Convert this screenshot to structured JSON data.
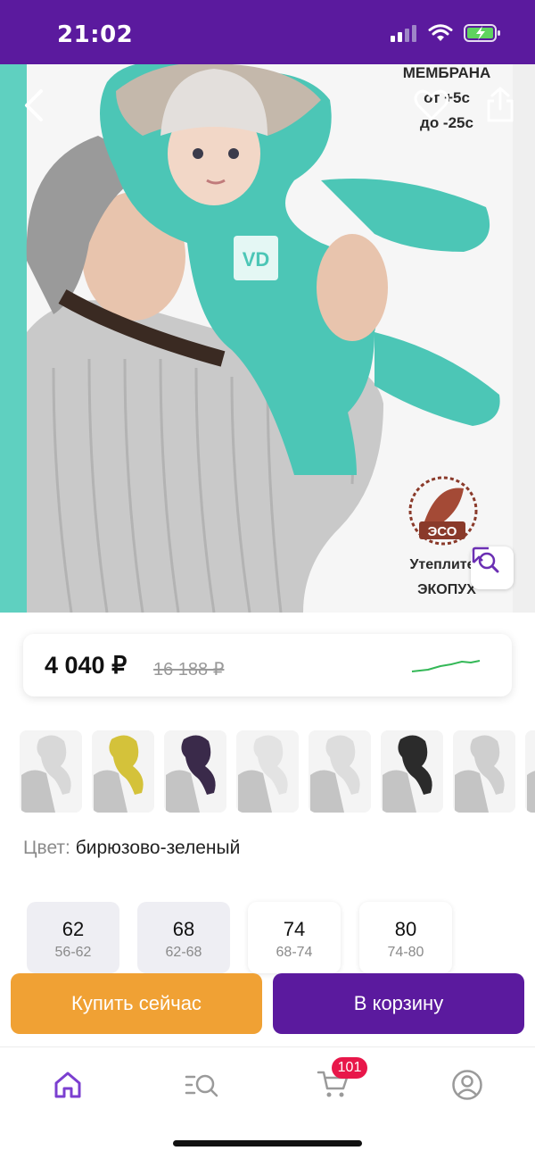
{
  "status_bar": {
    "time": "21:02"
  },
  "hero": {
    "text_membrane_line1": "МЕМБРАНА",
    "text_membrane_line2": "от +5с",
    "text_membrane_line3": "до -25с",
    "eco_stamp": "ЭСО",
    "insulation_line1": "Утеплитель",
    "insulation_line2": "ЭКОПУХ",
    "logo_text": "VD"
  },
  "price": {
    "current": "4 040 ₽",
    "old": "16 188 ₽"
  },
  "variants": {
    "count": 8,
    "colors": [
      "#d8d8d8",
      "#d4c23a",
      "#3a2a4a",
      "#e3e3e3",
      "#dddddd",
      "#2b2b2b",
      "#cfcfcf",
      "#d2d2d2"
    ]
  },
  "color": {
    "label": "Цвет:",
    "value": "бирюзово-зеленый"
  },
  "sizes": [
    {
      "size": "62",
      "range": "56-62"
    },
    {
      "size": "68",
      "range": "62-68"
    },
    {
      "size": "74",
      "range": "68-74"
    },
    {
      "size": "80",
      "range": "74-80"
    }
  ],
  "actions": {
    "buy_now": "Купить сейчас",
    "add_to_cart": "В корзину"
  },
  "tab_bar": {
    "cart_badge": "101"
  },
  "colors": {
    "brand_purple": "#5b1a9e",
    "orange": "#f0a134",
    "badge_red": "#e8174a",
    "teal_product": "#4cc6b6",
    "sparkline_green": "#34b857"
  }
}
